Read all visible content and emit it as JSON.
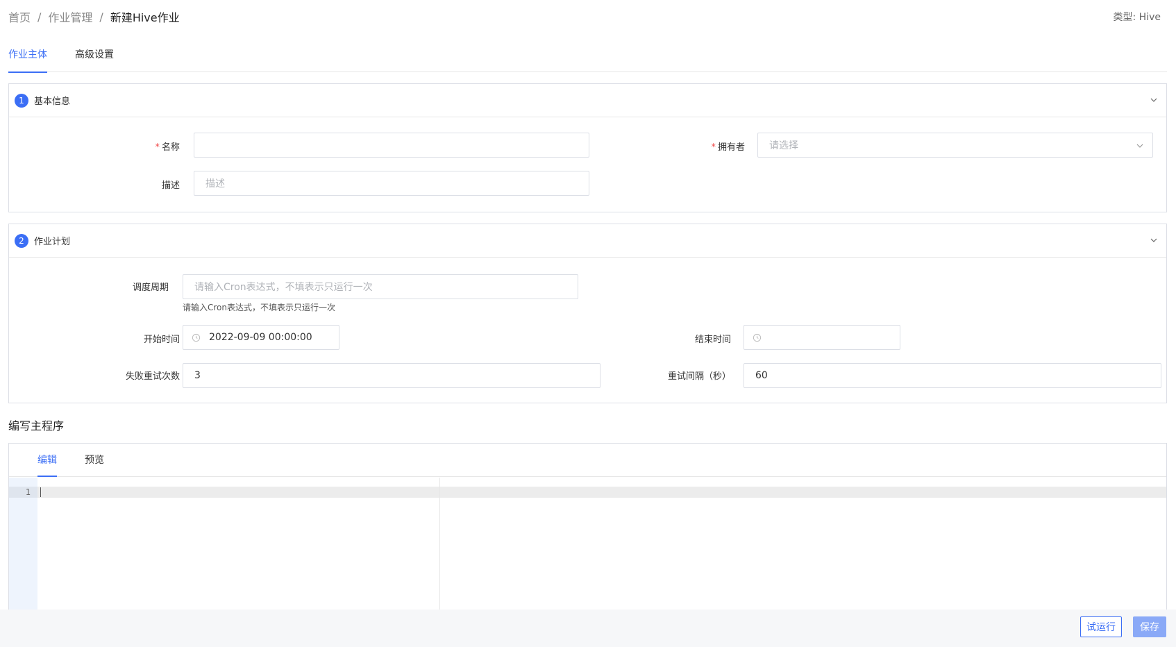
{
  "breadcrumb": {
    "home": "首页",
    "jobs": "作业管理",
    "current": "新建Hive作业",
    "separator": "/"
  },
  "type_label": "类型: Hive",
  "main_tabs": [
    {
      "label": "作业主体",
      "active": true
    },
    {
      "label": "高级设置",
      "active": false
    }
  ],
  "basic_info": {
    "step": "1",
    "title": "基本信息",
    "name_label": "名称",
    "name_value": "",
    "owner_label": "拥有者",
    "owner_placeholder": "请选择",
    "desc_label": "描述",
    "desc_placeholder": "描述",
    "required_mark": "*"
  },
  "job_plan": {
    "step": "2",
    "title": "作业计划",
    "schedule_label": "调度周期",
    "schedule_placeholder": "请输入Cron表达式，不填表示只运行一次",
    "schedule_hint": "请输入Cron表达式，不填表示只运行一次",
    "start_label": "开始时间",
    "start_value": "2022-09-09 00:00:00",
    "end_label": "结束时间",
    "end_value": "",
    "retry_label": "失败重试次数",
    "retry_value": "3",
    "interval_label": "重试间隔（秒）",
    "interval_value": "60"
  },
  "editor": {
    "section_title": "编写主程序",
    "tabs": [
      {
        "label": "编辑",
        "active": true
      },
      {
        "label": "预览",
        "active": false
      }
    ],
    "line_number": "1"
  },
  "footer": {
    "run_label": "试运行",
    "save_label": "保存"
  },
  "colors": {
    "accent": "#3b6ef5",
    "required": "#f04848",
    "save_button": "#8aa9f7"
  },
  "icons": [
    "chevron-down-icon",
    "clock-icon"
  ]
}
